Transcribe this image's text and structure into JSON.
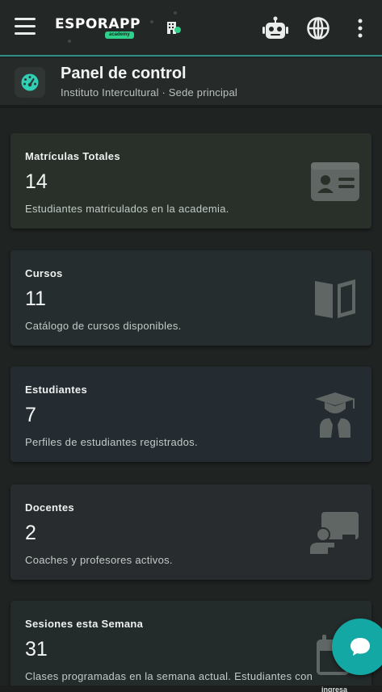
{
  "appbar": {
    "logo_text": "ESPORAPP",
    "logo_sub": "academy",
    "colors": {
      "accent": "#2f8f86",
      "logo_badge": "#2fd08a"
    }
  },
  "header": {
    "title": "Panel de control",
    "subtitle": "Instituto Intercultural · Sede principal",
    "icon": "gauge-icon"
  },
  "cards": [
    {
      "title": "Matrículas Totales",
      "value": "14",
      "description": "Estudiantes matriculados en la academia.",
      "icon": "id-card-icon",
      "bg": "#283029"
    },
    {
      "title": "Cursos",
      "value": "11",
      "description": "Catálogo de cursos disponibles.",
      "icon": "book-open-icon",
      "bg": "#262d2f"
    },
    {
      "title": "Estudiantes",
      "value": "7",
      "description": "Perfiles de estudiantes registrados.",
      "icon": "user-graduate-icon",
      "bg": "#242b31"
    },
    {
      "title": "Docentes",
      "value": "2",
      "description": "Coaches y profesores activos.",
      "icon": "chalkboard-teacher-icon",
      "bg": "#282c2e"
    },
    {
      "title": "Sesiones esta Semana",
      "value": "31",
      "description": "Clases programadas en la semana actual. Estudiantes con activos / programados.",
      "icon": "calendar-icon",
      "bg": "#242b2b"
    }
  ],
  "fab": {
    "icon": "chat-bubble-icon",
    "color": "#14a8a4"
  },
  "footer": {
    "text": "ingresa"
  }
}
